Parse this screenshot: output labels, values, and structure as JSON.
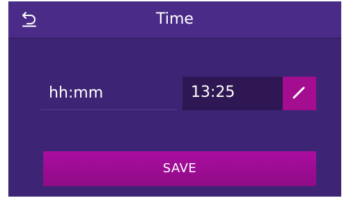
{
  "header": {
    "title": "Time",
    "back_icon": "back-arrow-icon"
  },
  "time_setting": {
    "format_label": "hh:mm",
    "value": "13:25",
    "edit_icon": "pencil-icon"
  },
  "actions": {
    "save_label": "SAVE"
  },
  "colors": {
    "background": "#3e2475",
    "header": "#4a2c88",
    "field": "#2e1752",
    "accent": "#a40d90",
    "text": "#ffffff"
  }
}
